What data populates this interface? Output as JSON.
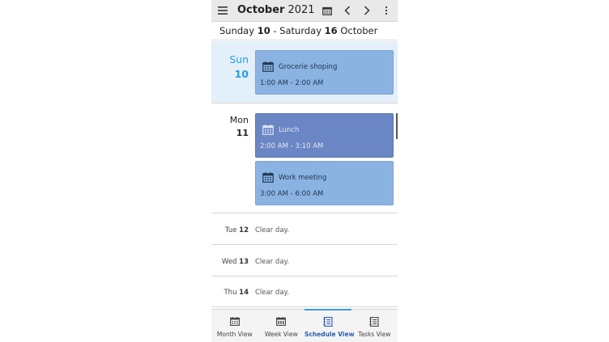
{
  "header": {
    "month": "October",
    "year": "2021",
    "menu_icon": "hamburger-menu-icon",
    "calendar_icon": "calendar-icon",
    "prev_icon": "chevron-left-icon",
    "next_icon": "chevron-right-icon",
    "more_icon": "more-vertical-icon"
  },
  "range": {
    "start_weekday": "Sunday",
    "start_day": "10",
    "separator": "-",
    "end_weekday": "Saturday",
    "end_day": "16",
    "end_month": "October"
  },
  "days": [
    {
      "name": "Sun",
      "number": "10",
      "events": [
        {
          "title": "Grocerie shoping",
          "time": "1:00 AM - 2:00 AM"
        }
      ]
    },
    {
      "name": "Mon",
      "number": "11",
      "events": [
        {
          "title": "Lunch",
          "time": "2:00 AM - 3:10 AM"
        },
        {
          "title": "Work meeting",
          "time": "3:00 AM - 6:00 AM"
        }
      ]
    }
  ],
  "clear_days": [
    {
      "name": "Tue",
      "number": "12",
      "message": "Clear day."
    },
    {
      "name": "Wed",
      "number": "13",
      "message": "Clear day."
    },
    {
      "name": "Thu",
      "number": "14",
      "message": "Clear day."
    }
  ],
  "nav": [
    {
      "label": "Month View",
      "icon": "month-view-icon",
      "active": false
    },
    {
      "label": "Week View",
      "icon": "week-view-icon",
      "active": false
    },
    {
      "label": "Schedule View",
      "icon": "schedule-view-icon",
      "active": true
    },
    {
      "label": "Tasks View",
      "icon": "tasks-view-icon",
      "active": false
    }
  ],
  "colors": {
    "accent": "#2b9be0",
    "event_light": "#8bb3e2",
    "event_dark": "#6a86c4",
    "today_bg": "#e3f0fa",
    "active_tab": "#2a5db0"
  }
}
